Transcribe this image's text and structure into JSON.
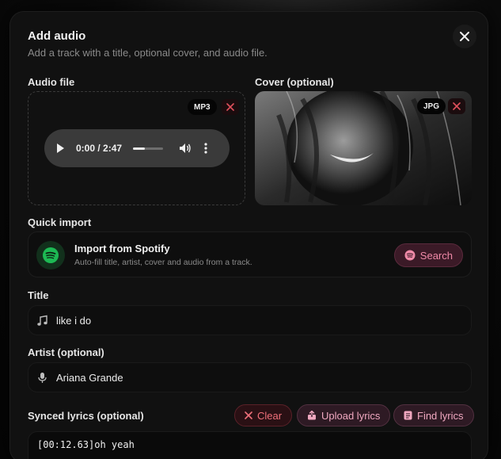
{
  "modal": {
    "title": "Add audio",
    "subtitle": "Add a track with a title, optional cover, and audio file."
  },
  "audio": {
    "label": "Audio file",
    "format_tag": "MP3",
    "player_time": "0:00 / 2:47",
    "progress_fraction": 0.0,
    "volume_fraction": 0.4
  },
  "cover": {
    "label": "Cover (optional)",
    "format_tag": "JPG"
  },
  "quick_import": {
    "label": "Quick import",
    "title": "Import from Spotify",
    "subtitle": "Auto-fill title, artist, cover and audio from a track.",
    "search_label": "Search"
  },
  "title_field": {
    "label": "Title",
    "value": "like i do"
  },
  "artist_field": {
    "label": "Artist (optional)",
    "value": "Ariana Grande"
  },
  "lyrics": {
    "label": "Synced lyrics (optional)",
    "clear_label": "Clear",
    "upload_label": "Upload lyrics",
    "find_label": "Find lyrics",
    "first_line": "[00:12.63]oh yeah"
  },
  "colors": {
    "accent_pink": "#f08aa8",
    "spotify_green": "#1db954",
    "danger_red": "#e0505c"
  }
}
